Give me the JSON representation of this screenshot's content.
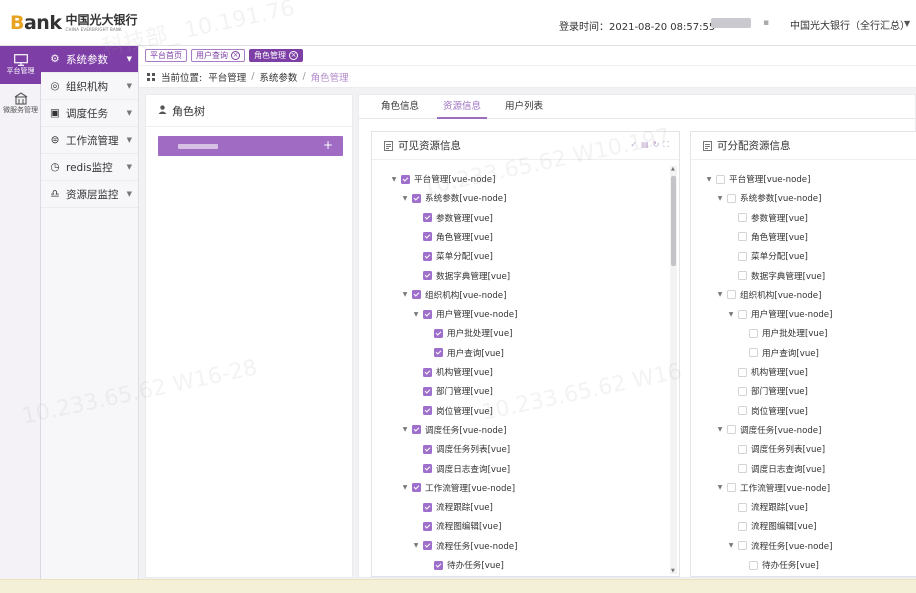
{
  "header": {
    "logo_word": "ank",
    "logo_letter": "B",
    "logo_cn": "中国光大银行",
    "logo_en": "CHINA EVERBRIGHT BANK",
    "login_time": "登录时间：2021-08-20 08:57:55",
    "org": "中国光大银行（全行汇总）"
  },
  "iconbar": [
    {
      "label": "平台管理",
      "icon": "monitor-icon",
      "active": true
    },
    {
      "label": "微服务管理",
      "icon": "building-icon",
      "active": false
    }
  ],
  "sidebar": {
    "items": [
      {
        "label": "系统参数",
        "icon": "gear-icon"
      },
      {
        "label": "组织机构",
        "icon": "org-icon"
      },
      {
        "label": "调度任务",
        "icon": "calendar-icon"
      },
      {
        "label": "工作流管理",
        "icon": "flow-icon"
      },
      {
        "label": "redis监控",
        "icon": "clock-icon"
      },
      {
        "label": "资源层监控",
        "icon": "bell-icon"
      }
    ]
  },
  "tabbar": [
    {
      "label": "平台首页",
      "closable": false,
      "active": false
    },
    {
      "label": "用户查询",
      "closable": true,
      "active": false
    },
    {
      "label": "角色管理",
      "closable": true,
      "active": true
    }
  ],
  "breadcrumb": {
    "prefix": "当前位置:",
    "items": [
      "平台管理",
      "系统参数",
      "角色管理"
    ]
  },
  "role_panel": {
    "title": "角色树",
    "plus": "+"
  },
  "main_tabs": [
    "角色信息",
    "资源信息",
    "用户列表"
  ],
  "visible_box": {
    "title": "可见资源信息"
  },
  "assignable_box": {
    "title": "可分配资源信息"
  },
  "tree": [
    {
      "label": "平台管理[vue-node]",
      "level": 0,
      "arrow": true
    },
    {
      "label": "系统参数[vue-node]",
      "level": 1,
      "arrow": true
    },
    {
      "label": "参数管理[vue]",
      "level": 2,
      "arrow": false
    },
    {
      "label": "角色管理[vue]",
      "level": 2,
      "arrow": false
    },
    {
      "label": "菜单分配[vue]",
      "level": 2,
      "arrow": false
    },
    {
      "label": "数据字典管理[vue]",
      "level": 2,
      "arrow": false
    },
    {
      "label": "组织机构[vue-node]",
      "level": 1,
      "arrow": true
    },
    {
      "label": "用户管理[vue-node]",
      "level": 2,
      "arrow": true
    },
    {
      "label": "用户批处理[vue]",
      "level": 3,
      "arrow": false
    },
    {
      "label": "用户查询[vue]",
      "level": 3,
      "arrow": false
    },
    {
      "label": "机构管理[vue]",
      "level": 2,
      "arrow": false
    },
    {
      "label": "部门管理[vue]",
      "level": 2,
      "arrow": false
    },
    {
      "label": "岗位管理[vue]",
      "level": 2,
      "arrow": false
    },
    {
      "label": "调度任务[vue-node]",
      "level": 1,
      "arrow": true
    },
    {
      "label": "调度任务列表[vue]",
      "level": 2,
      "arrow": false
    },
    {
      "label": "调度日志查询[vue]",
      "level": 2,
      "arrow": false
    },
    {
      "label": "工作流管理[vue-node]",
      "level": 1,
      "arrow": true
    },
    {
      "label": "流程跟踪[vue]",
      "level": 2,
      "arrow": false
    },
    {
      "label": "流程图编辑[vue]",
      "level": 2,
      "arrow": false
    },
    {
      "label": "流程任务[vue-node]",
      "level": 2,
      "arrow": true
    },
    {
      "label": "待办任务[vue]",
      "level": 3,
      "arrow": false
    }
  ],
  "colors": {
    "primary": "#7d3fa6",
    "checkbox": "#9f6fcc",
    "accent_light": "#b28ac8"
  }
}
